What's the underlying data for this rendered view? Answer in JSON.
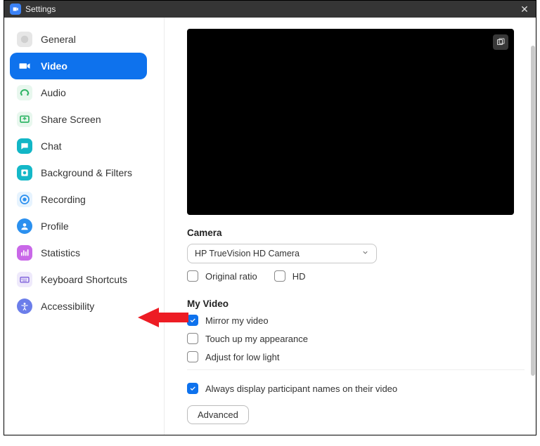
{
  "titlebar": {
    "title": "Settings"
  },
  "sidebar": {
    "items": [
      {
        "label": "General"
      },
      {
        "label": "Video"
      },
      {
        "label": "Audio"
      },
      {
        "label": "Share Screen"
      },
      {
        "label": "Chat"
      },
      {
        "label": "Background & Filters"
      },
      {
        "label": "Recording"
      },
      {
        "label": "Profile"
      },
      {
        "label": "Statistics"
      },
      {
        "label": "Keyboard Shortcuts"
      },
      {
        "label": "Accessibility"
      }
    ]
  },
  "camera": {
    "section": "Camera",
    "selected": "HP TrueVision HD Camera",
    "original_ratio": "Original ratio",
    "hd": "HD"
  },
  "myvideo": {
    "section": "My Video",
    "mirror": "Mirror my video",
    "touchup": "Touch up my appearance",
    "lowlight": "Adjust for low light"
  },
  "participants": {
    "display_names": "Always display participant names on their video"
  },
  "advanced": {
    "label": "Advanced"
  },
  "colors": {
    "accent": "#0e72ed"
  }
}
